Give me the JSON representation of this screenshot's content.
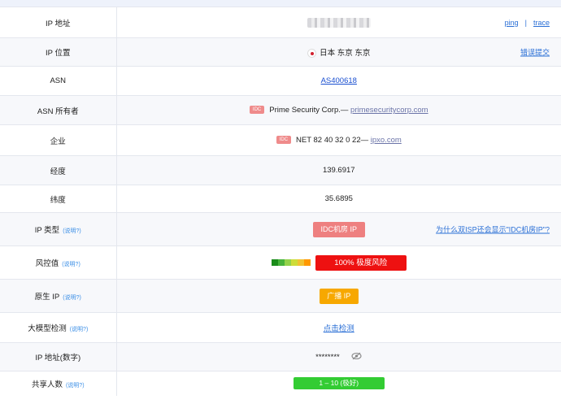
{
  "rows": {
    "ip": {
      "label": "IP 地址",
      "ping": "ping",
      "sep": "|",
      "trace": "trace"
    },
    "location": {
      "label": "IP 位置",
      "value": "日本 东京 东京",
      "report": "错误提交",
      "flag_icon": "japan-flag-icon"
    },
    "asn": {
      "label": "ASN",
      "value": "AS400618"
    },
    "asn_owner": {
      "label": "ASN 所有者",
      "badge": "IDC",
      "name": "Prime Security Corp.—",
      "domain": "primesecuritycorp.com"
    },
    "company": {
      "label": "企业",
      "badge": "IDC",
      "name": "NET 82 40 32 0 22—",
      "domain": "ipxo.com"
    },
    "longitude": {
      "label": "经度",
      "value": "139.6917"
    },
    "latitude": {
      "label": "纬度",
      "value": "35.6895"
    },
    "ip_type": {
      "label": "IP 类型",
      "explain": "(说明?)",
      "value": "IDC机房 IP",
      "why": "为什么双ISP还会显示\"IDC机房IP\"?"
    },
    "risk": {
      "label": "风控值",
      "explain": "(说明?)",
      "value": "100%   极度风险",
      "percent": 100,
      "bar_colors": [
        "#1a8c1a",
        "#47b33a",
        "#93d24a",
        "#cddc39",
        "#f1c232",
        "#ff9800"
      ]
    },
    "native_ip": {
      "label": "原生 IP",
      "explain": "(说明?)",
      "value": "广播 IP"
    },
    "llm_detect": {
      "label": "大模型检测",
      "explain": "(说明?)",
      "value": "点击检测"
    },
    "ip_numeric": {
      "label": "IP 地址(数字)",
      "value": "********",
      "icon": "eye-off-icon"
    },
    "shared_users": {
      "label": "共享人数",
      "explain": "(说明?)",
      "value": "1 – 10 (极好)"
    }
  },
  "colors": {
    "link": "#2a6fd6",
    "idc": "#ee8080",
    "risk": "#ee1111",
    "broadcast": "#f7a800",
    "share": "#33cc33"
  }
}
